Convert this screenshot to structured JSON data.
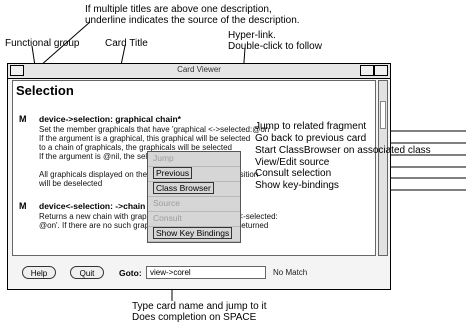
{
  "annotations": {
    "multiple_titles_line1": "If multiple titles are above one description,",
    "multiple_titles_line2": "underline indicates the source of the description.",
    "hyperlink_line1": "Hyper-link.",
    "hyperlink_line2": "Double-click to follow",
    "functional_group": "Functional group",
    "card_title": "Card Title",
    "jump_related": "Jump to related fragment",
    "go_back": "Go back to previous card",
    "start_class_browser": "Start ClassBrowser on associated class",
    "view_edit_source": "View/Edit source",
    "consult_selection": "Consult selection",
    "show_key_bindings": "Show key-bindings",
    "type_card_line1": "Type card name and jump to it",
    "type_card_line2": "Does completion on SPACE"
  },
  "window": {
    "title": "Card Viewer",
    "group_title": "Selection",
    "entries": [
      {
        "mark": "M",
        "title": "device->selection: graphical chain*",
        "lines": [
          "Set the member graphicals that have 'graphical <->selected:@on'",
          "If the argument is a graphical, this graphical will be selected",
          "to a chain of graphicals, the graphicals will be selected",
          "If the argument is @nil, the selection is cleared",
          "",
          "All graphicals displayed on the device in the indicated position",
          "will be deselected"
        ]
      },
      {
        "mark": "M",
        "title": "device<-selection: ->chain",
        "lines": [
          "Returns a new chain with graphicals that have 'graphical<-selected:",
          "@on'. If there are no such graphicals, an empty chain is returned"
        ]
      }
    ],
    "menu": [
      "Jump",
      "Previous",
      "Class Browser",
      "Source",
      "Consult",
      "Show Key Bindings"
    ],
    "help_button": "Help",
    "quit_button": "Quit",
    "goto_label": "Goto:",
    "goto_value": "view->corel",
    "status": "No Match"
  }
}
